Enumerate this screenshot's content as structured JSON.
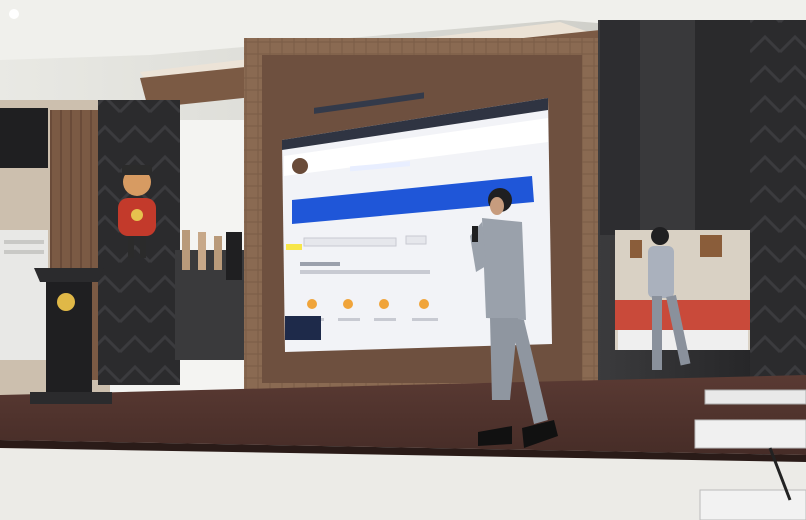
{
  "scene": {
    "screen": {
      "title": "",
      "button_label": "",
      "steps": [
        "",
        "",
        "",
        ""
      ]
    },
    "colors": {
      "ceiling": "#dcdcd6",
      "wood_panel": "#7b5a44",
      "frame": "#8a6a52",
      "screen_bg": "#f2f3f7",
      "screen_header": "#2f3442",
      "blue_banner": "#1f56d8",
      "highlight_yellow": "#f7e64a",
      "stage_floor": "#4b2f2a",
      "dark_wall": "#2b2b2d",
      "uniform": "#9aa1ab"
    }
  }
}
